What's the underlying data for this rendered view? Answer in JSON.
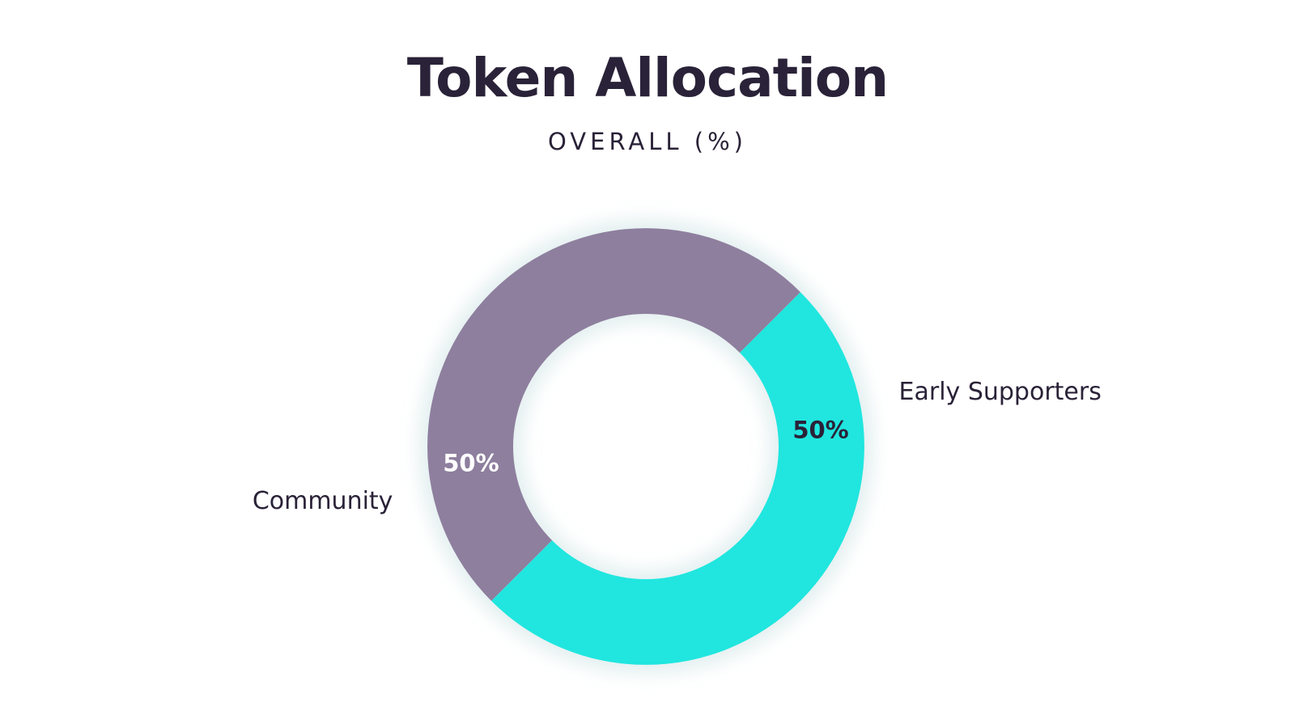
{
  "chart_data": {
    "type": "pie",
    "style": "donut",
    "title": "Token Allocation",
    "subtitle": "OVERALL (%)",
    "slices": [
      {
        "label": "Early Supporters",
        "value": 50,
        "value_label": "50%",
        "color": "#20e6df",
        "value_text_color": "#2a2238"
      },
      {
        "label": "Community",
        "value": 50,
        "value_label": "50%",
        "color": "#8e7f9e",
        "value_text_color": "#ffffff"
      }
    ]
  }
}
